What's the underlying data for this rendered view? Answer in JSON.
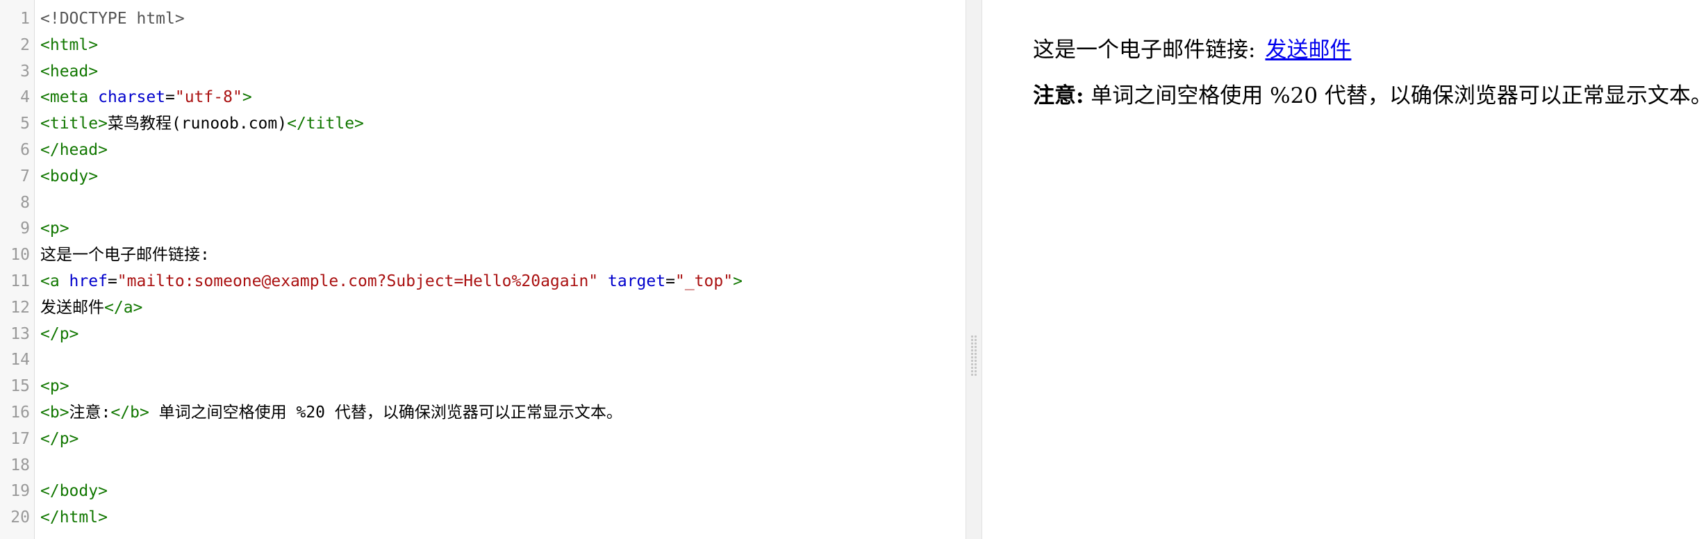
{
  "editor": {
    "lines": [
      [
        {
          "t": "<!DOCTYPE html>",
          "c": "meta"
        }
      ],
      [
        {
          "t": "<html>",
          "c": "tag"
        }
      ],
      [
        {
          "t": "<head>",
          "c": "tag"
        }
      ],
      [
        {
          "t": "<meta ",
          "c": "tag"
        },
        {
          "t": "charset",
          "c": "attr"
        },
        {
          "t": "=",
          "c": "text"
        },
        {
          "t": "\"utf-8\"",
          "c": "str"
        },
        {
          "t": ">",
          "c": "tag"
        }
      ],
      [
        {
          "t": "<title>",
          "c": "tag"
        },
        {
          "t": "菜鸟教程(runoob.com)",
          "c": "text"
        },
        {
          "t": "</title>",
          "c": "tag"
        }
      ],
      [
        {
          "t": "</head>",
          "c": "tag"
        }
      ],
      [
        {
          "t": "<body>",
          "c": "tag"
        }
      ],
      [],
      [
        {
          "t": "<p>",
          "c": "tag"
        }
      ],
      [
        {
          "t": "这是一个电子邮件链接:",
          "c": "text"
        }
      ],
      [
        {
          "t": "<a ",
          "c": "tag"
        },
        {
          "t": "href",
          "c": "attr"
        },
        {
          "t": "=",
          "c": "text"
        },
        {
          "t": "\"mailto:someone@example.com?Subject=Hello%20again\"",
          "c": "str"
        },
        {
          "t": " ",
          "c": "text"
        },
        {
          "t": "target",
          "c": "attr"
        },
        {
          "t": "=",
          "c": "text"
        },
        {
          "t": "\"_top\"",
          "c": "str"
        },
        {
          "t": ">",
          "c": "tag"
        }
      ],
      [
        {
          "t": "发送邮件",
          "c": "text"
        },
        {
          "t": "</a>",
          "c": "tag"
        }
      ],
      [
        {
          "t": "</p>",
          "c": "tag"
        }
      ],
      [],
      [
        {
          "t": "<p>",
          "c": "tag"
        }
      ],
      [
        {
          "t": "<b>",
          "c": "tag"
        },
        {
          "t": "注意:",
          "c": "text"
        },
        {
          "t": "</b>",
          "c": "tag"
        },
        {
          "t": " 单词之间空格使用 %20 代替，以确保浏览器可以正常显示文本。",
          "c": "text"
        }
      ],
      [
        {
          "t": "</p>",
          "c": "tag"
        }
      ],
      [],
      [
        {
          "t": "</body>",
          "c": "tag"
        }
      ],
      [
        {
          "t": "</html>",
          "c": "tag"
        }
      ]
    ]
  },
  "colors": {
    "tag": "#117700",
    "attr": "#0000cc",
    "string": "#aa1111",
    "meta": "#555555",
    "link": "#0000ee",
    "gutter_bg": "#f7f7f7"
  },
  "preview": {
    "para1_text": "这是一个电子邮件链接:",
    "link_text": "发送邮件",
    "note_bold": "注意:",
    "note_text": " 单词之间空格使用 %20 代替，以确保浏览器可以正常显示文本。"
  },
  "icons": {
    "splitter_grip": "drag-grip-icon"
  }
}
